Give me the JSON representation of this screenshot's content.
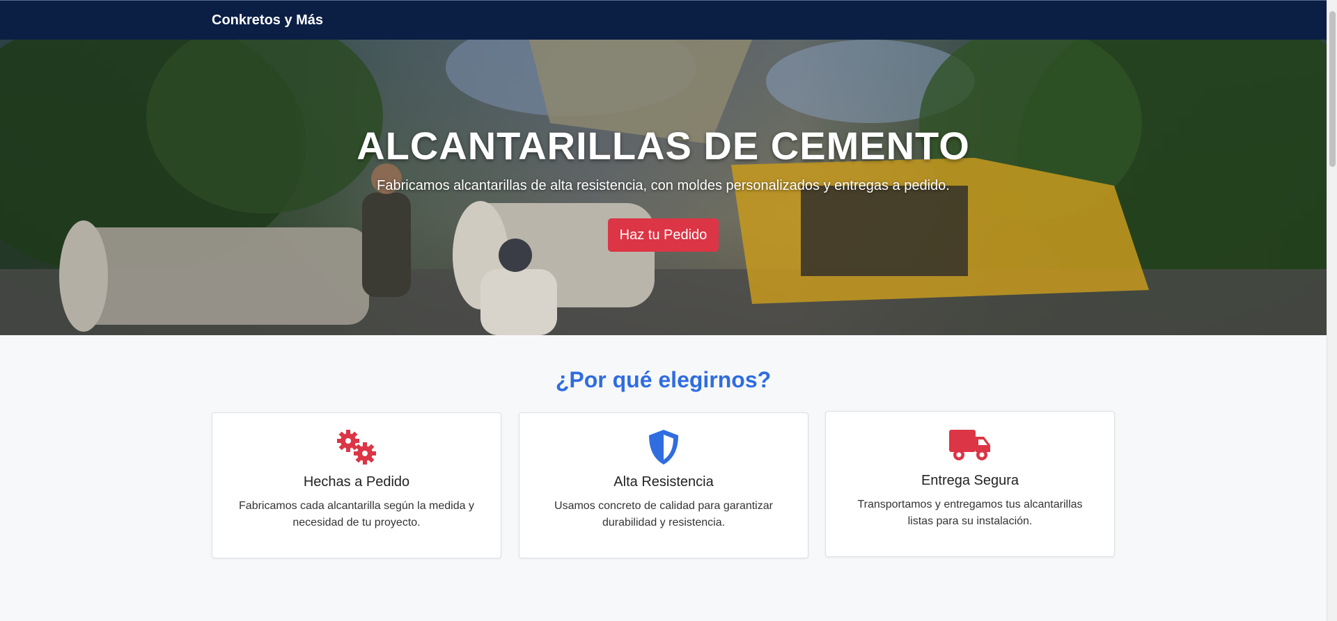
{
  "navbar": {
    "brand": "Conkretos y Más"
  },
  "hero": {
    "title": "ALCANTARILLAS DE CEMENTO",
    "subtitle": "Fabricamos alcantarillas de alta resistencia, con moldes personalizados y entregas a pedido.",
    "cta_label": "Haz tu Pedido"
  },
  "features": {
    "title": "¿Por qué elegirnos?",
    "cards": [
      {
        "icon": "gears-icon",
        "title": "Hechas a Pedido",
        "text": "Fabricamos cada alcantarilla según la medida y necesidad de tu proyecto."
      },
      {
        "icon": "shield-icon",
        "title": "Alta Resistencia",
        "text": "Usamos concreto de calidad para garantizar durabilidad y resistencia."
      },
      {
        "icon": "truck-icon",
        "title": "Entrega Segura",
        "text": "Transportamos y entregamos tus alcantarillas listas para su instalación."
      }
    ]
  },
  "colors": {
    "navbar_bg": "#0b1f45",
    "accent_red": "#dc3545",
    "accent_blue": "#2f6de0"
  }
}
